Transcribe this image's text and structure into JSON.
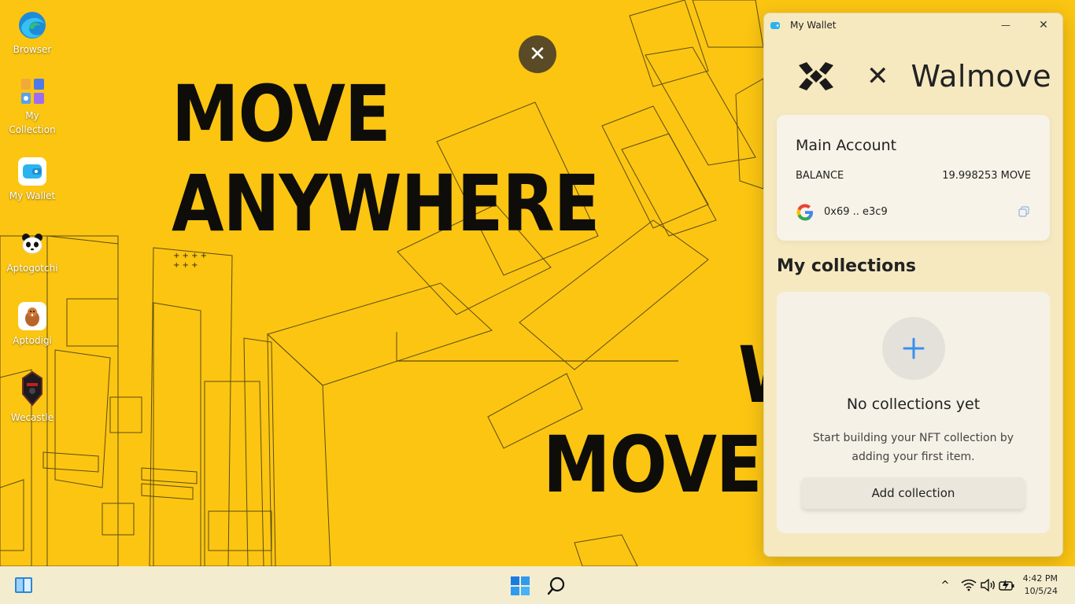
{
  "desktop": {
    "hero_line1": "MOVE",
    "hero_line2": "ANYWHERE",
    "hero_line3": "MOVEM",
    "hero_fragment": "W",
    "close_glyph": "✕",
    "icons": [
      {
        "label": "Browser",
        "icon": "edge-browser-icon"
      },
      {
        "label": "My Collection",
        "icon": "collection-icon"
      },
      {
        "label": "My Wallet",
        "icon": "wallet-icon"
      },
      {
        "label": "Aptogotchi",
        "icon": "panda-icon"
      },
      {
        "label": "Aptodigi",
        "icon": "beaver-icon"
      },
      {
        "label": "Wecastle",
        "icon": "knight-icon"
      }
    ]
  },
  "wallet": {
    "window_title": "My Wallet",
    "minimize_glyph": "—",
    "close_glyph": "✕",
    "brand_x": "✕",
    "brand_name": "Walmove",
    "account": {
      "title": "Main Account",
      "balance_label": "BALANCE",
      "balance_value": "19.998253 MOVE",
      "address": "0x69 .. e3c9"
    },
    "collections": {
      "title": "My collections",
      "empty_title": "No collections yet",
      "empty_desc": "Start building your NFT collection by adding your first item.",
      "add_button": "Add collection"
    }
  },
  "taskbar": {
    "time": "4:42 PM",
    "date": "10/5/24",
    "tray_chevron": "^"
  },
  "colors": {
    "wallpaper": "#fbc512",
    "wallet_bg": "#f6e9c0",
    "accent_blue": "#3b8ef0",
    "taskbar": "#f3ecce"
  }
}
